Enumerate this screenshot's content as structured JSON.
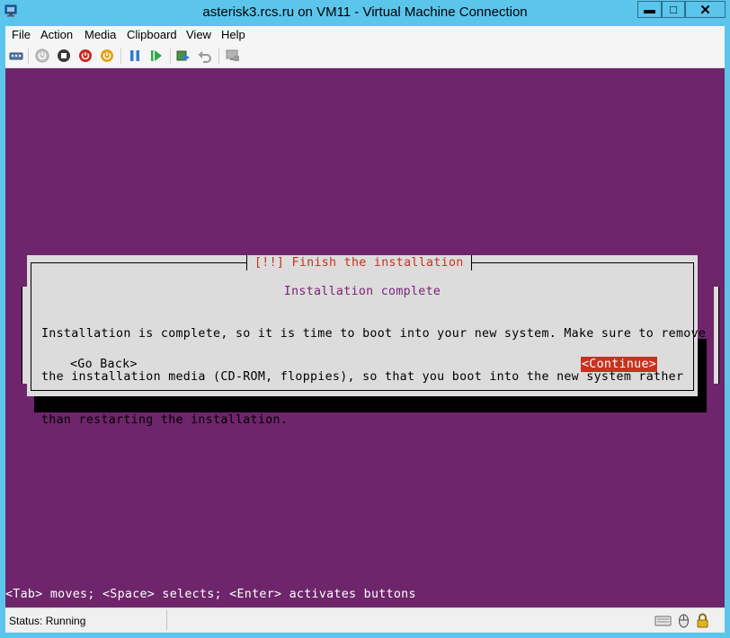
{
  "window": {
    "title": "asterisk3.rcs.ru on VM11 - Virtual Machine Connection"
  },
  "window_controls": {
    "minimize": "▬",
    "maximize": "□",
    "close": "✕"
  },
  "menu": [
    "File",
    "Action",
    "Media",
    "Clipboard",
    "View",
    "Help"
  ],
  "toolbar": [
    "ctrl-alt-del-icon",
    "start-icon",
    "turn-off-icon",
    "shutdown-icon",
    "save-state-icon",
    "pause-icon",
    "resume-icon",
    "checkpoint-icon",
    "revert-icon",
    "enhanced-session-icon"
  ],
  "console": {
    "dialog_title": "[!!] Finish the installation",
    "heading": "Installation complete",
    "message_lines": [
      "Installation is complete, so it is time to boot into your new system. Make sure to remove",
      "the installation media (CD-ROM, floppies), so that you boot into the new system rather",
      "than restarting the installation."
    ],
    "back_button": "<Go Back>",
    "continue_button": "<Continue>",
    "hint": "<Tab> moves; <Space> selects; <Enter> activates buttons"
  },
  "status": {
    "text": "Status: Running"
  },
  "colors": {
    "console_bg": "#6e256b",
    "dialog_bg": "#dcdcdc",
    "accent_red": "#c8321f",
    "title_bar": "#5bc5ec"
  }
}
